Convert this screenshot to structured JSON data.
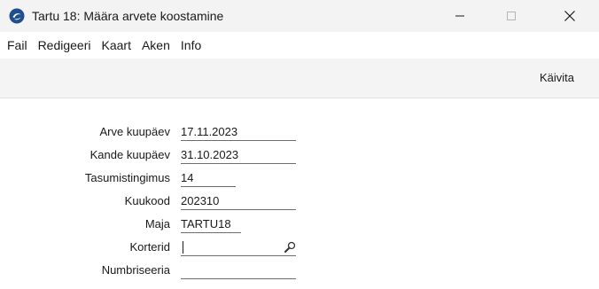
{
  "window": {
    "title": "Tartu 18: Määra arvete koostamine",
    "controls": [
      "minimize-icon",
      "maximize-icon",
      "close-icon"
    ]
  },
  "menu": {
    "items": [
      "Fail",
      "Redigeeri",
      "Kaart",
      "Aken",
      "Info"
    ]
  },
  "toolbar": {
    "run_label": "Käivita"
  },
  "form": {
    "fields": [
      {
        "label": "Arve kuupäev",
        "value": "17.11.2023"
      },
      {
        "label": "Kande kuupäev",
        "value": "31.10.2023"
      },
      {
        "label": "Tasumistingimus",
        "value": "14"
      },
      {
        "label": "Kuukood",
        "value": "202310"
      },
      {
        "label": "Maja",
        "value": "TARTU18"
      },
      {
        "label": "Korterid",
        "value": "",
        "icon": "magnifier-icon"
      },
      {
        "label": "Numbriseeria",
        "value": ""
      }
    ]
  },
  "colors": {
    "titlebar_bg": "#f3f3f3",
    "toolbar_bg": "#f4f4f4",
    "app_icon_blue": "#1f4f8f"
  }
}
